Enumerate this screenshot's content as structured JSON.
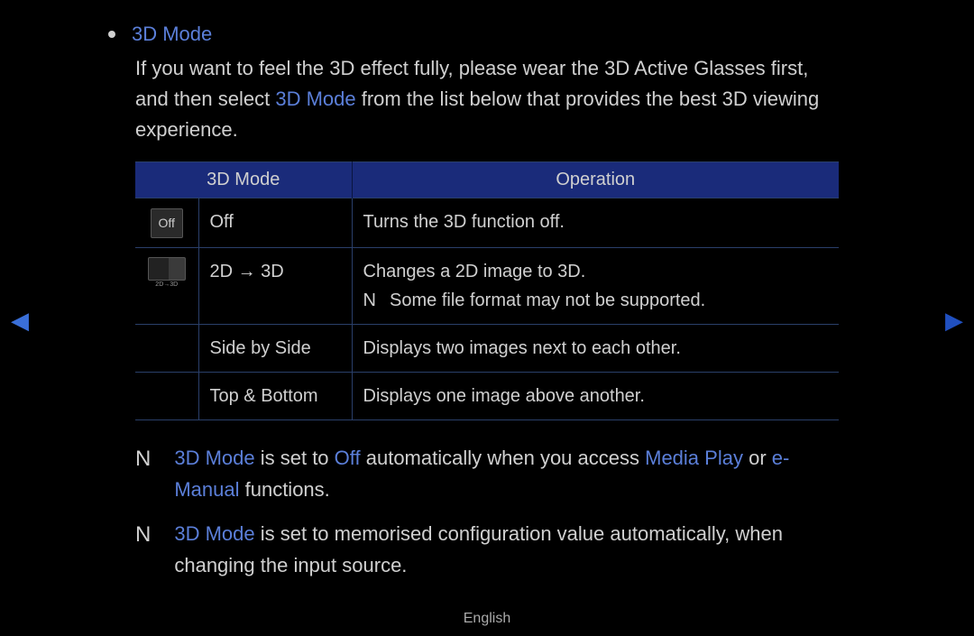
{
  "title": "3D Mode",
  "intro_part1": "If you want to feel the 3D effect fully, please wear the 3D Active Glasses first, and then select ",
  "intro_highlight": "3D Mode",
  "intro_part2": " from the list below that provides the best 3D viewing experience.",
  "table": {
    "headers": [
      "3D Mode",
      "Operation"
    ],
    "rows": [
      {
        "icon": "off",
        "icon_label": "Off",
        "mode": "Off",
        "operation": "Turns the 3D function off."
      },
      {
        "icon": "2d3d",
        "icon_label": "2D→3D",
        "mode": "2D → 3D",
        "operation": "Changes a 2D image to 3D.",
        "note_prefix": "N",
        "note_text": "Some file format may not be supported."
      },
      {
        "icon": "",
        "mode": "Side by Side",
        "operation": "Displays two images next to each other."
      },
      {
        "icon": "",
        "mode": "Top & Bottom",
        "operation": "Displays one image above another."
      }
    ]
  },
  "notes": [
    {
      "marker": "N",
      "segments": [
        {
          "t": "3D Mode",
          "blue": true
        },
        {
          "t": " is set to "
        },
        {
          "t": "Off",
          "blue": true
        },
        {
          "t": " automatically when you access "
        },
        {
          "t": "Media Play",
          "blue": true
        },
        {
          "t": " or "
        },
        {
          "t": "e-Manual",
          "blue": true
        },
        {
          "t": " functions."
        }
      ]
    },
    {
      "marker": "N",
      "segments": [
        {
          "t": "3D Mode",
          "blue": true
        },
        {
          "t": " is set to memorised configuration value automatically, when changing the input source."
        }
      ]
    }
  ],
  "footer": "English",
  "arrows": {
    "left": "◀",
    "right": "▶"
  }
}
